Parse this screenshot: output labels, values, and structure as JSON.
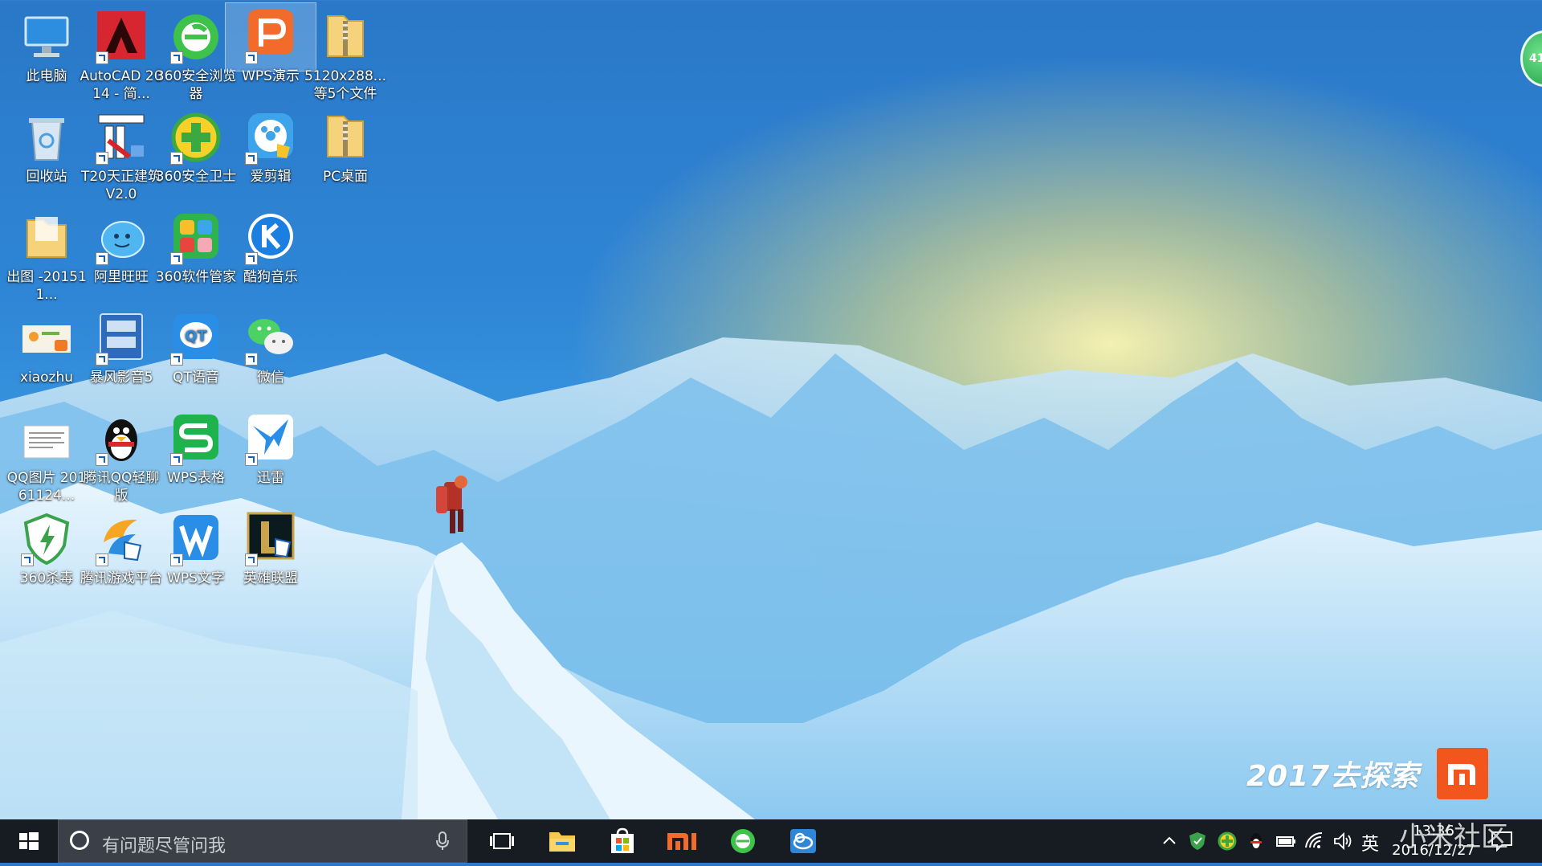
{
  "desktop": {
    "icons": [
      {
        "label": "此电脑",
        "icon": "computer-icon"
      },
      {
        "label": "AutoCAD 2014 - 简...",
        "icon": "autocad-icon"
      },
      {
        "label": "360安全浏览器",
        "icon": "browser-360-icon"
      },
      {
        "label": "WPS演示",
        "icon": "wps-presentation-icon"
      },
      {
        "label": "5120x288... 等5个文件",
        "icon": "zip-folder-icon"
      },
      {
        "label": "回收站",
        "icon": "recycle-bin-icon"
      },
      {
        "label": "T20天正建筑 V2.0",
        "icon": "t20-architecture-icon"
      },
      {
        "label": "360安全卫士",
        "icon": "security-360-icon"
      },
      {
        "label": "爱剪辑",
        "icon": "video-editor-icon"
      },
      {
        "label": "PC桌面",
        "icon": "zip-folder-icon"
      },
      {
        "label": "出图 -201511...",
        "icon": "folder-icon"
      },
      {
        "label": "阿里旺旺",
        "icon": "aliwangwang-icon"
      },
      {
        "label": "360软件管家",
        "icon": "software-manager-icon"
      },
      {
        "label": "酷狗音乐",
        "icon": "kugou-music-icon"
      },
      {
        "label": "xiaozhu",
        "icon": "image-file-icon"
      },
      {
        "label": "暴风影音5",
        "icon": "media-player-icon"
      },
      {
        "label": "QT语音",
        "icon": "qt-voice-icon"
      },
      {
        "label": "微信",
        "icon": "wechat-icon"
      },
      {
        "label": "QQ图片 20161124...",
        "icon": "document-image-icon"
      },
      {
        "label": "腾讯QQ轻聊版",
        "icon": "qq-penguin-icon"
      },
      {
        "label": "WPS表格",
        "icon": "wps-spreadsheet-icon"
      },
      {
        "label": "迅雷",
        "icon": "xunlei-bird-icon"
      },
      {
        "label": "360杀毒",
        "icon": "antivirus-360-icon"
      },
      {
        "label": "腾讯游戏平台",
        "icon": "tencent-games-icon"
      },
      {
        "label": "WPS文字",
        "icon": "wps-writer-icon"
      },
      {
        "label": "英雄联盟",
        "icon": "league-of-legends-icon"
      }
    ],
    "selected": "WPS演示"
  },
  "edge_widget": {
    "text": "41"
  },
  "brand": {
    "text": "2017去探索",
    "logo_text": "mi"
  },
  "taskbar": {
    "search_placeholder": "有问题尽管问我",
    "apps": [
      "task-view-icon",
      "file-explorer-icon",
      "store-icon",
      "mi-app-icon",
      "browser-360-icon",
      "cloud-app-icon"
    ],
    "ime": "英",
    "clock_time": "13:36",
    "clock_date": "2016/12/27"
  },
  "watermark": "小米社区",
  "colors": {
    "taskbar": "#171b22",
    "search": "#3b3f47",
    "mi_orange": "#f2561d",
    "sky": "#2f86d6"
  }
}
